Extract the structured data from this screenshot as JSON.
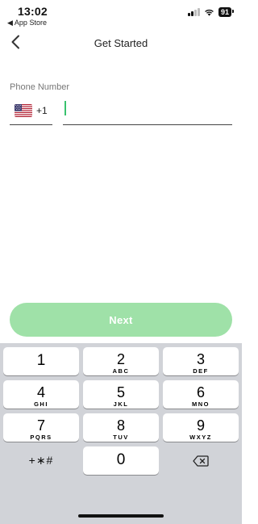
{
  "status_bar": {
    "time": "13:02",
    "back_app": "◀ App Store",
    "battery": "91"
  },
  "nav": {
    "title": "Get Started",
    "back_icon": "chevron-left-icon"
  },
  "form": {
    "phone_label": "Phone Number",
    "country_flag": "us-flag-icon",
    "dial_code": "+1",
    "phone_value": "",
    "phone_placeholder": ""
  },
  "next_button": {
    "label": "Next",
    "color": "#9fe1a8"
  },
  "keypad": {
    "keys": [
      {
        "num": "1",
        "letters": ""
      },
      {
        "num": "2",
        "letters": "ABC"
      },
      {
        "num": "3",
        "letters": "DEF"
      },
      {
        "num": "4",
        "letters": "GHI"
      },
      {
        "num": "5",
        "letters": "JKL"
      },
      {
        "num": "6",
        "letters": "MNO"
      },
      {
        "num": "7",
        "letters": "PQRS"
      },
      {
        "num": "8",
        "letters": "TUV"
      },
      {
        "num": "9",
        "letters": "WXYZ"
      },
      {
        "num": "0",
        "letters": ""
      }
    ],
    "symbols_label": "+∗#",
    "delete_icon": "backspace-icon"
  },
  "colors": {
    "accent": "#39c26e",
    "keyboard_bg": "#d1d3d8"
  }
}
